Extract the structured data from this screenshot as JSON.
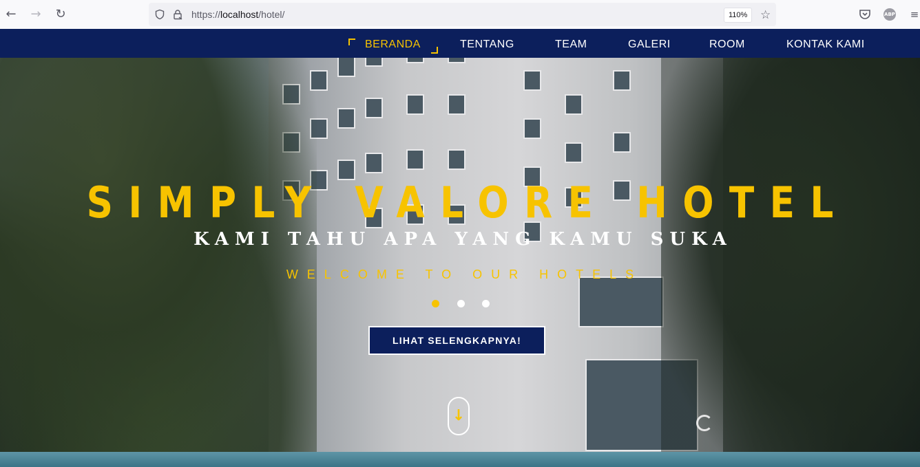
{
  "browser": {
    "url_prefix": "https://",
    "url_host": "localhost",
    "url_path": "/hotel/",
    "zoom": "110%",
    "icons": [
      "back-icon",
      "forward-icon",
      "reload-icon",
      "shield-icon",
      "lock-icon",
      "star-icon",
      "pocket-icon",
      "abp-icon",
      "menu-icon"
    ],
    "abp_label": "ABP"
  },
  "nav": {
    "items": [
      {
        "label": "BERANDA",
        "active": true
      },
      {
        "label": "TENTANG"
      },
      {
        "label": "TEAM"
      },
      {
        "label": "GALERI"
      },
      {
        "label": "ROOM"
      },
      {
        "label": "KONTAK KAMI"
      }
    ]
  },
  "hero": {
    "title": "SIMPLY VALORE HOTEL",
    "subtitle": "KAMI TAHU APA YANG KAMU SUKA",
    "tagline": "WELCOME TO OUR HOTELS",
    "slides": 3,
    "active_slide": 1,
    "cta_label": "LIHAT SELENGKAPNYA!",
    "scroll_icon": "arrow-down-icon"
  },
  "colors": {
    "accent": "#f7c300",
    "navbar": "#0c1f5c"
  }
}
